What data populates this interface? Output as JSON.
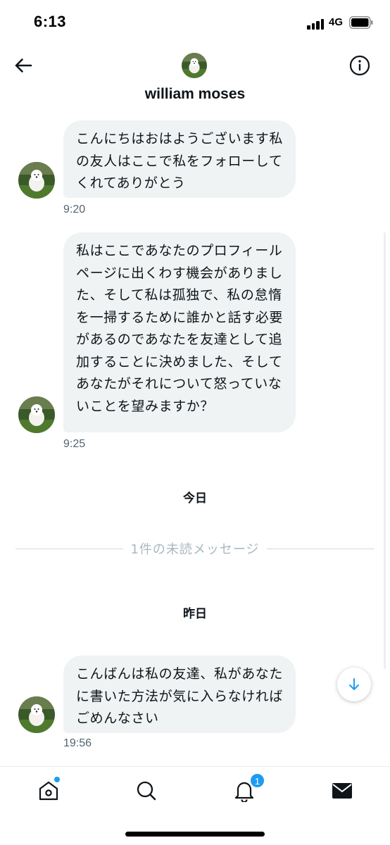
{
  "status_bar": {
    "time": "6:13",
    "network": "4G"
  },
  "header": {
    "name": "william moses"
  },
  "messages": [
    {
      "text": "こんにちはおはようございます私の友人はここで私をフォローしてくれてありがとう",
      "time": "9:20"
    },
    {
      "text": "私はここであなたのプロフィールページに出くわす機会がありました、そして私は孤独で、私の怠惰を一掃するために誰かと話す必要があるのであなたを友達として追加することに決めました、そしてあなたがそれについて怒っていないことを望みますか？",
      "time": "9:25"
    },
    {
      "text": "こんばんは私の友達、私があなたに書いた方法が気に入らなければごめんなさい",
      "time": "19:56"
    }
  ],
  "dividers": {
    "today": "今日",
    "unread": "1件の未読メッセージ",
    "yesterday": "昨日"
  },
  "tab_bar": {
    "notifications_badge": "1"
  },
  "icons": [
    "back-arrow-icon",
    "info-icon",
    "home-icon",
    "search-icon",
    "bell-icon",
    "mail-icon",
    "arrow-down-icon"
  ],
  "colors": {
    "accent": "#1d9bf0",
    "bubble": "#eff3f4",
    "muted": "#536471"
  }
}
